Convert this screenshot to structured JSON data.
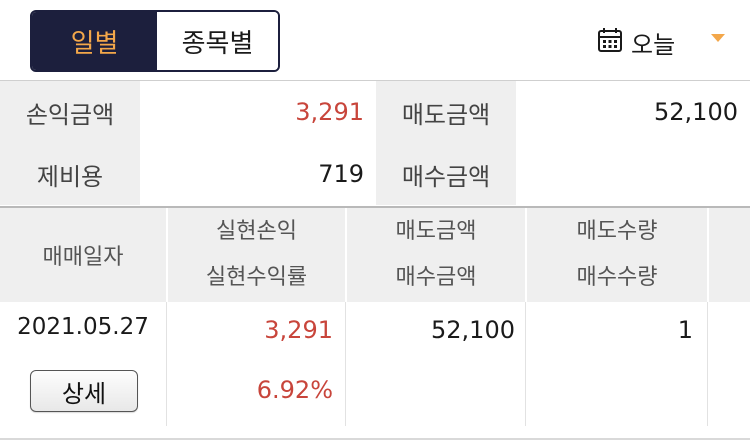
{
  "period_tabs": [
    {
      "label": "일별",
      "active": true
    },
    {
      "label": "종목별",
      "active": false
    }
  ],
  "date_filter": {
    "icon": "calendar-icon",
    "label": "오늘",
    "dropdown_icon": "caret-down-icon"
  },
  "summary": {
    "profit_label": "손익금액",
    "profit_value": "3,291",
    "sell_label": "매도금액",
    "sell_value": "52,100",
    "fees_label": "제비용",
    "fees_value": "719",
    "buy_label": "매수금액",
    "buy_value": ""
  },
  "table": {
    "headers": {
      "date": "매매일자",
      "pnl_top": "실현손익",
      "pnl_bottom": "실현수익률",
      "amount_top": "매도금액",
      "amount_bottom": "매수금액",
      "qty_top": "매도수량",
      "qty_bottom": "매수수량"
    },
    "rows": [
      {
        "date": "2021.05.27",
        "detail_button": "상세",
        "realized_pnl": "3,291",
        "realized_return": "6.92%",
        "sell_amount": "52,100",
        "buy_amount": "",
        "sell_qty": "1",
        "buy_qty": ""
      }
    ]
  },
  "colors": {
    "navy": "#1c1f3d",
    "accent": "#f3a74a",
    "profit_red": "#c8453b",
    "header_bg": "#efefef"
  }
}
